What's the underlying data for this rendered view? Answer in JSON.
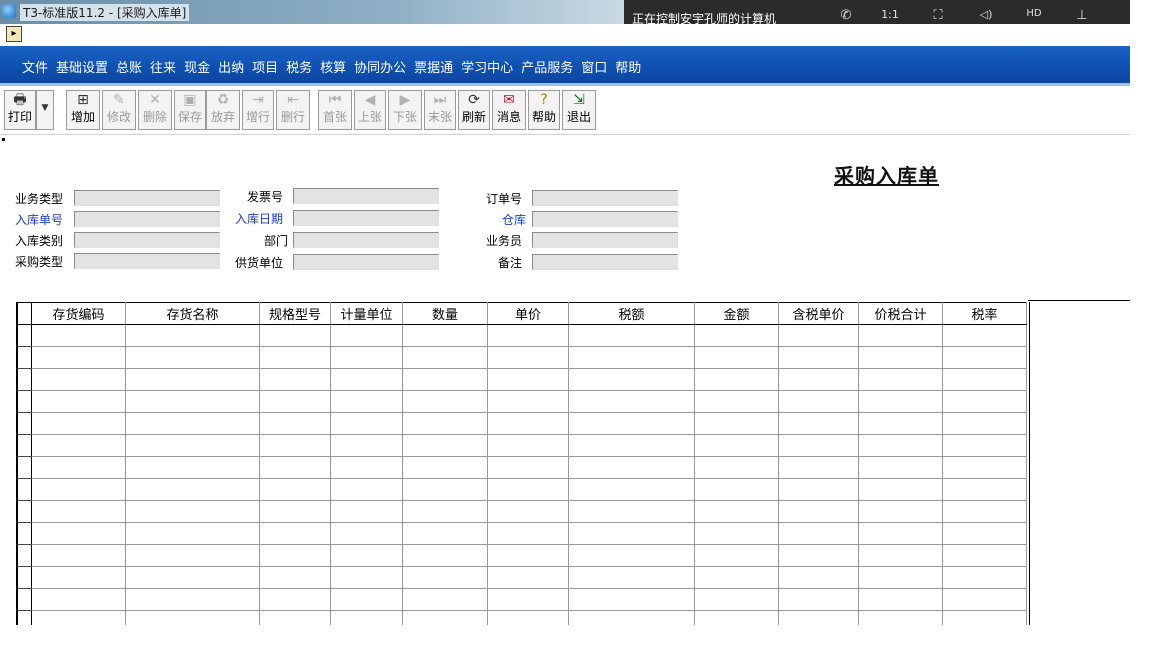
{
  "window": {
    "title": "T3-标准版11.2 - [采购入库单]"
  },
  "remote": {
    "title": "正在控制安宇孔师的计算机",
    "icons": [
      "phone-icon",
      "ratio-icon",
      "fullscreen-icon",
      "volume-icon",
      "hd-icon",
      "pin-icon"
    ],
    "icon_glyphs": [
      "✆",
      "1:1",
      "⛶",
      "◁)",
      "HD",
      "⊥"
    ]
  },
  "menu": [
    "文件",
    "基础设置",
    "总账",
    "往来",
    "现金",
    "出纳",
    "项目",
    "税务",
    "核算",
    "协同办公",
    "票据通",
    "学习中心",
    "产品服务",
    "窗口",
    "帮助"
  ],
  "toolbar": [
    {
      "name": "print",
      "label": "打印",
      "icon": "print-icon",
      "glyph": "🖶",
      "enabled": true
    },
    {
      "name": "add",
      "label": "增加",
      "icon": "add-icon",
      "glyph": "⊞",
      "enabled": true
    },
    {
      "name": "edit",
      "label": "修改",
      "icon": "edit-icon",
      "glyph": "✎",
      "enabled": false
    },
    {
      "name": "delete",
      "label": "删除",
      "icon": "delete-icon",
      "glyph": "✕",
      "enabled": false
    },
    {
      "name": "save",
      "label": "保存",
      "icon": "save-icon",
      "glyph": "▣",
      "enabled": false
    },
    {
      "name": "abandon",
      "label": "放弃",
      "icon": "abandon-icon",
      "glyph": "♻",
      "enabled": false
    },
    {
      "name": "add-row",
      "label": "增行",
      "icon": "add-row-icon",
      "glyph": "⇥",
      "enabled": false
    },
    {
      "name": "delete-row",
      "label": "删行",
      "icon": "delete-row-icon",
      "glyph": "⇤",
      "enabled": false
    },
    {
      "name": "first",
      "label": "首张",
      "icon": "first-icon",
      "glyph": "⏮",
      "enabled": false
    },
    {
      "name": "prev",
      "label": "上张",
      "icon": "prev-icon",
      "glyph": "◀",
      "enabled": false
    },
    {
      "name": "next",
      "label": "下张",
      "icon": "next-icon",
      "glyph": "▶",
      "enabled": false
    },
    {
      "name": "last",
      "label": "末张",
      "icon": "last-icon",
      "glyph": "⏭",
      "enabled": false
    },
    {
      "name": "refresh",
      "label": "刷新",
      "icon": "refresh-icon",
      "glyph": "⟳",
      "enabled": true
    },
    {
      "name": "message",
      "label": "消息",
      "icon": "message-icon",
      "glyph": "✉",
      "enabled": true
    },
    {
      "name": "help",
      "label": "帮助",
      "icon": "help-icon",
      "glyph": "?",
      "enabled": true
    },
    {
      "name": "exit",
      "label": "退出",
      "icon": "exit-icon",
      "glyph": "⇲",
      "enabled": true
    }
  ],
  "form": {
    "title": "采购入库单",
    "fields": {
      "business_type": "业务类型",
      "invoice_no": "发票号",
      "order_no": "订单号",
      "receipt_no": "入库单号",
      "receipt_date": "入库日期",
      "warehouse": "仓库",
      "receipt_category": "入库类别",
      "department": "部门",
      "salesperson": "业务员",
      "purchase_type": "采购类型",
      "supplier": "供货单位",
      "remark": "备注"
    }
  },
  "table": {
    "columns": [
      "存货编码",
      "存货名称",
      "规格型号",
      "计量单位",
      "数量",
      "单价",
      "税额",
      "金额",
      "含税单价",
      "价税合计",
      "税率"
    ],
    "empty_rows": 14
  },
  "colors": {
    "menubar": "#0f4fb0",
    "required_label": "#1a3cc8",
    "input_bg": "#e3e3e3"
  }
}
